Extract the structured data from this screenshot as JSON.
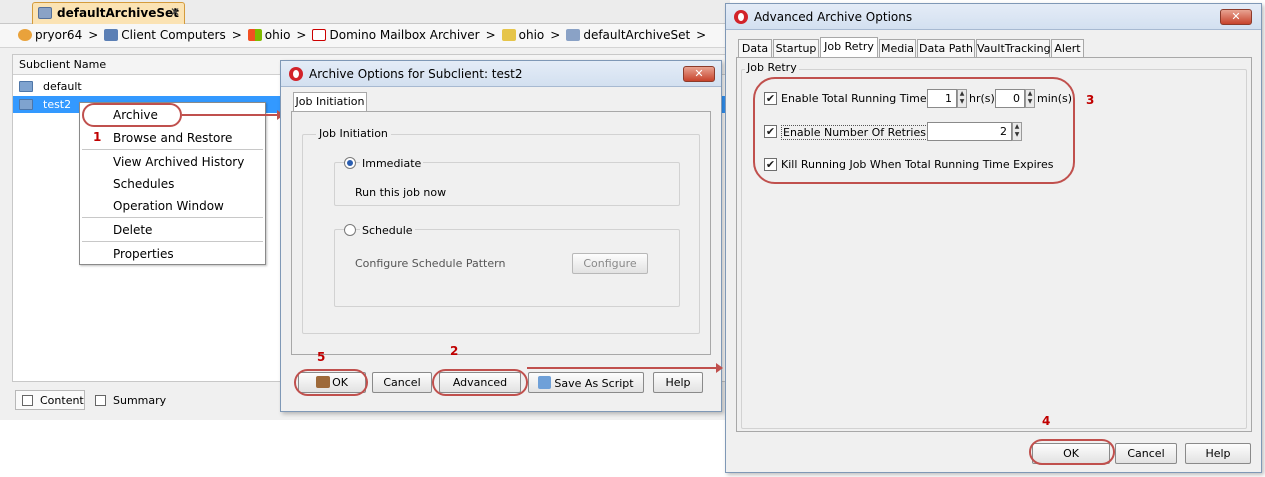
{
  "main": {
    "doc_tab": "defaultArchiveSet",
    "breadcrumb": [
      "pryor64",
      "Client Computers",
      "ohio",
      "Domino Mailbox Archiver",
      "ohio",
      "defaultArchiveSet"
    ],
    "column_header": "Subclient Name",
    "rows": [
      "default",
      "test2"
    ],
    "bottom_tabs": [
      "Content",
      "Summary"
    ]
  },
  "context_menu": {
    "items": [
      "Archive",
      "Browse and Restore",
      "View Archived History",
      "Schedules",
      "Operation Window",
      "Delete",
      "Properties"
    ]
  },
  "archive_dialog": {
    "title": "Archive Options for Subclient: test2",
    "tab": "Job Initiation",
    "group_title": "Job Initiation",
    "immediate_label": "Immediate",
    "immediate_desc": "Run this job now",
    "schedule_label": "Schedule",
    "schedule_desc": "Configure Schedule Pattern",
    "configure_button": "Configure",
    "buttons": {
      "ok": "OK",
      "cancel": "Cancel",
      "advanced": "Advanced",
      "save_script": "Save As Script",
      "help": "Help"
    }
  },
  "advanced_dialog": {
    "title": "Advanced Archive Options",
    "tabs": [
      "Data",
      "Startup",
      "Job Retry",
      "Media",
      "Data Path",
      "VaultTracking",
      "Alert"
    ],
    "active_tab": "Job Retry",
    "group_title": "Job Retry",
    "enable_total_running_time": "Enable Total Running Time",
    "hours_value": "1",
    "hours_unit": "hr(s)",
    "mins_value": "0",
    "mins_unit": "min(s)",
    "enable_retries": "Enable Number Of Retries",
    "retries_value": "2",
    "kill_job": "Kill Running Job When Total Running Time Expires",
    "buttons": {
      "ok": "OK",
      "cancel": "Cancel",
      "help": "Help"
    }
  },
  "annotations": {
    "n1": "1",
    "n2": "2",
    "n3": "3",
    "n4": "4",
    "n5": "5"
  },
  "colors": {
    "annotation": "#c0504d",
    "selection": "#3399ff",
    "tab_highlight": "#fbe3b4"
  }
}
